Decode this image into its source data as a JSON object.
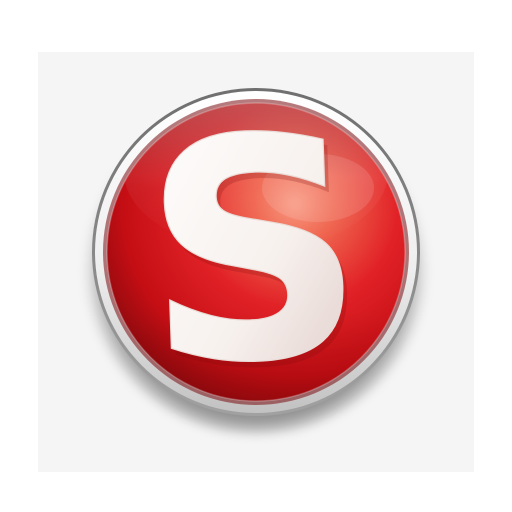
{
  "app_icon": {
    "letter": "S",
    "icon_name": "s-logo-icon",
    "colors": {
      "background": "#ffffff",
      "backdrop": "#f5f5f5",
      "rim_light": "#f7f7f7",
      "rim_dark": "#8a8a8a",
      "disc_bright": "#f0664f",
      "disc_mid": "#d8191f",
      "disc_dark": "#8e0a0e",
      "letter_light": "#fbf8f6",
      "letter_shadow": "#e2c8c2"
    }
  }
}
